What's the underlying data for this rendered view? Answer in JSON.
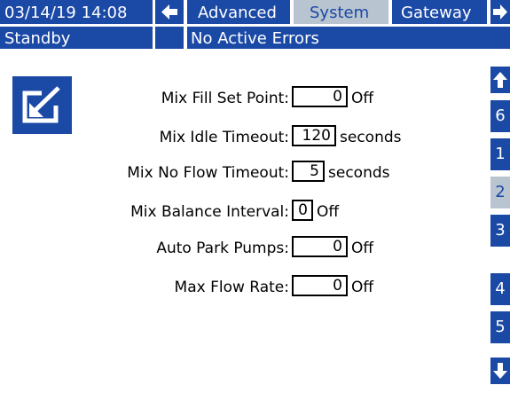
{
  "header": {
    "datetime": "03/14/19 14:08",
    "tabs": [
      "Advanced",
      "System",
      "Gateway"
    ],
    "selected_tab": "System"
  },
  "status": {
    "state": "Standby",
    "errors": "No Active Errors"
  },
  "fields": [
    {
      "label": "Mix Fill Set Point:",
      "value": "0",
      "unit": "Off"
    },
    {
      "label": "Mix Idle Timeout:",
      "value": "120",
      "unit": "seconds"
    },
    {
      "label": "Mix No Flow Timeout:",
      "value": "5",
      "unit": "seconds"
    },
    {
      "label": "Mix Balance Interval:",
      "value": "0",
      "unit": "Off"
    },
    {
      "label": "Auto Park Pumps:",
      "value": "0",
      "unit": "Off"
    },
    {
      "label": "Max Flow Rate:",
      "value": "0",
      "unit": "Off"
    }
  ],
  "sidebar": {
    "pages": [
      "6",
      "1",
      "2",
      "3",
      "4",
      "5"
    ],
    "selected_page": "2"
  },
  "colors": {
    "accent": "#1b49a6",
    "selected": "#b8c4cf"
  },
  "icons": [
    "left-arrow-icon",
    "right-arrow-icon",
    "up-arrow-icon",
    "down-arrow-icon",
    "edit-icon"
  ]
}
